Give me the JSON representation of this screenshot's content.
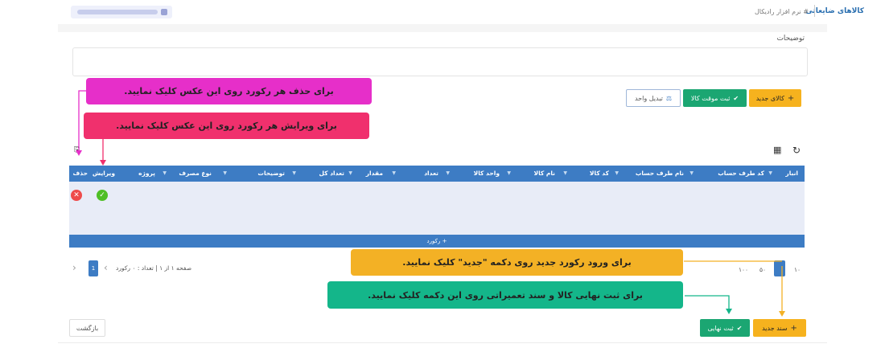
{
  "header": {
    "breadcrumb_title": "کالاهای ضایعاتی",
    "breadcrumb_path": "# نرم افزار رادیکال"
  },
  "form": {
    "description_label": "توضیحات",
    "description_value": ""
  },
  "toolbar": {
    "new_item_label": "کالای جدید",
    "temp_save_label": "ثبت موقت کالا",
    "convert_unit_label": "تبدیل واحد"
  },
  "table": {
    "columns": [
      "انبار",
      "کد طرف حساب",
      "نام طرف حساب",
      "کد کالا",
      "نام کالا",
      "واحد کالا",
      "تعداد",
      "مقدار",
      "تعداد کل",
      "توضیحات",
      "نوع مصرف",
      "پروژه",
      "ویرایش",
      "حذف"
    ],
    "add_row_label": "+ رکورد"
  },
  "pagination": {
    "left_info": "صفحه ۱ از ۱ | تعداد : ۰ رکورد",
    "current_page": "1",
    "page_sizes": [
      "۱۰",
      "۵۰",
      "۱۰۰"
    ]
  },
  "footer": {
    "new_doc_label": "سند جدید",
    "final_save_label": "ثبت نهایی",
    "back_label": "بازگشت"
  },
  "annotations": {
    "delete_hint": "برای حذف هر رکورد روی این عکس کلیک نمایید.",
    "edit_hint": "برای ویرایش هر رکورد روی این عکس کلیک نمایید.",
    "new_hint": "برای ورود رکورد جدید روی دکمه \"جدید\" کلیک نمایید.",
    "final_hint": "برای ثبت نهایی کالا و سند تعمیراتی روی این دکمه کلیک نمایید."
  },
  "icons": {
    "plus": "plus-icon",
    "check": "check-icon",
    "refresh": "refresh-icon",
    "columns": "columns-icon",
    "copy": "copy-icon",
    "delete": "delete-icon",
    "edit": "edit-icon"
  },
  "colors": {
    "primary": "#3d7cc4",
    "orange": "#f6b21e",
    "green": "#1ba672",
    "magenta": "#e62fc9",
    "pink": "#f0306d",
    "annotation_orange": "#f3b125",
    "annotation_green": "#14b68a"
  }
}
